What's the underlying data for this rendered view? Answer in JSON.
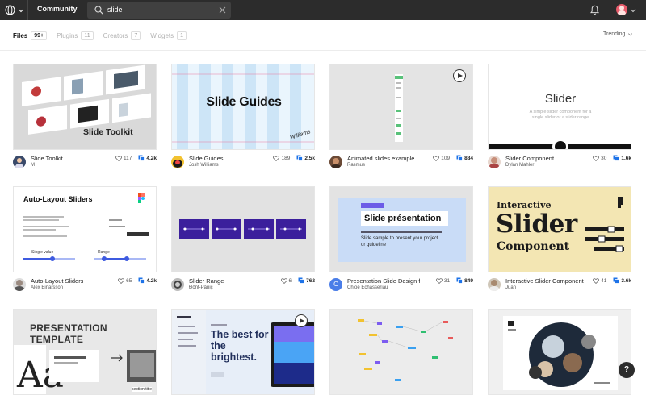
{
  "topbar": {
    "community_label": "Community",
    "search_value": "slide"
  },
  "tabs": [
    {
      "label": "Files",
      "count": "99+"
    },
    {
      "label": "Plugins",
      "count": "11"
    },
    {
      "label": "Creators",
      "count": "7"
    },
    {
      "label": "Widgets",
      "count": "1"
    }
  ],
  "sort_label": "Trending",
  "cards": [
    {
      "title": "Slide Toolkit",
      "author": "M",
      "likes": "117",
      "duplicates": "4.2k",
      "thumb_text": "Slide Toolkit"
    },
    {
      "title": "Slide Guides",
      "author": "Josh Williams",
      "likes": "189",
      "duplicates": "2.5k",
      "thumb_text": "Slide Guides",
      "thumb_sign": "Williams"
    },
    {
      "title": "Animated slides example",
      "author": "Rasmus",
      "likes": "109",
      "duplicates": "884"
    },
    {
      "title": "Slider Component",
      "author": "Dylan Mahler",
      "likes": "30",
      "duplicates": "1.6k",
      "thumb_text": "Slider",
      "thumb_sub": "A simple slider component for a single slider or a slider range"
    },
    {
      "title": "Auto-Layout Sliders",
      "author": "Alex Einarsson",
      "likes": "65",
      "duplicates": "4.2k",
      "thumb_text": "Auto-Layout Sliders",
      "thumb_labels": [
        "Single value",
        "Range"
      ]
    },
    {
      "title": "Slider Range",
      "author": "Đônt-Pâniç",
      "likes": "6",
      "duplicates": "762"
    },
    {
      "title": "Presentation Slide Design f…",
      "author": "Chloé Echasseriau",
      "likes": "31",
      "duplicates": "849",
      "avatar_letter": "C",
      "thumb_text": "Slide présentation",
      "thumb_sub": "Slide sample to present your project or guideline"
    },
    {
      "title": "Interactive Slider Component",
      "author": "Juan",
      "likes": "41",
      "duplicates": "3.6k",
      "thumb_lines": [
        "Interactive",
        "Slider",
        "Component"
      ]
    },
    {
      "title": "",
      "author": "",
      "likes": "",
      "duplicates": "",
      "thumb_text": "PRESENTATION TEMPLATE",
      "thumb_sub": "section title"
    },
    {
      "title": "",
      "author": "",
      "likes": "",
      "duplicates": "",
      "thumb_text": "The best for the brightest."
    },
    {
      "title": "",
      "author": "",
      "likes": "",
      "duplicates": ""
    },
    {
      "title": "",
      "author": "",
      "likes": "",
      "duplicates": ""
    }
  ],
  "help_label": "?",
  "colors": {
    "topbar": "#2c2c2c",
    "search_bg": "#404040",
    "duplicate_icon": "#1e73e8",
    "accent_purple": "#3b1f9c"
  }
}
